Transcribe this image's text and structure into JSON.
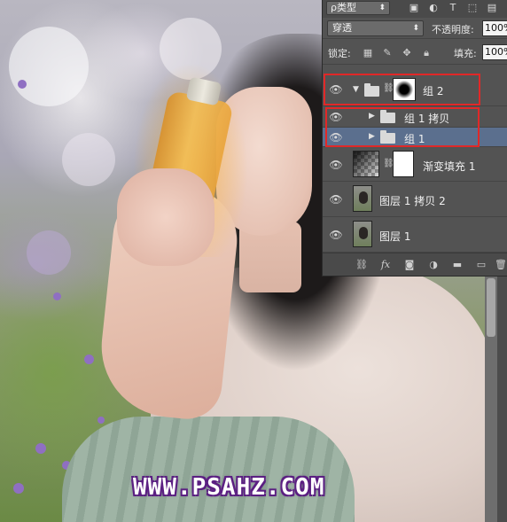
{
  "panel": {
    "filter": {
      "label": "ρ类型",
      "icons": [
        "image-filter-icon",
        "adjustment-filter-icon",
        "type-filter-icon",
        "shape-filter-icon",
        "smart-object-filter-icon"
      ]
    },
    "blend_mode": "穿透",
    "opacity_label": "不透明度:",
    "opacity_value": "100%",
    "lock_label": "锁定:",
    "fill_label": "填充:",
    "fill_value": "100%",
    "layers": [
      {
        "name": "组 2",
        "type": "group",
        "expanded": true,
        "has_mask": true
      },
      {
        "name": "组 1 拷贝",
        "type": "group",
        "expanded": false,
        "indent": true
      },
      {
        "name": "组 1",
        "type": "group",
        "expanded": false,
        "indent": true,
        "selected": true
      },
      {
        "name": "渐变填充 1",
        "type": "gradient-fill",
        "has_mask": true
      },
      {
        "name": "图层 1 拷贝 2",
        "type": "pixel"
      },
      {
        "name": "图层 1",
        "type": "pixel"
      }
    ]
  },
  "watermark": "WWW.PSAHZ.COM",
  "colors": {
    "panel_bg": "#535353",
    "selected_row": "#5b6f8e",
    "highlight_red": "#e12828",
    "watermark_outline": "#5b1f82"
  }
}
